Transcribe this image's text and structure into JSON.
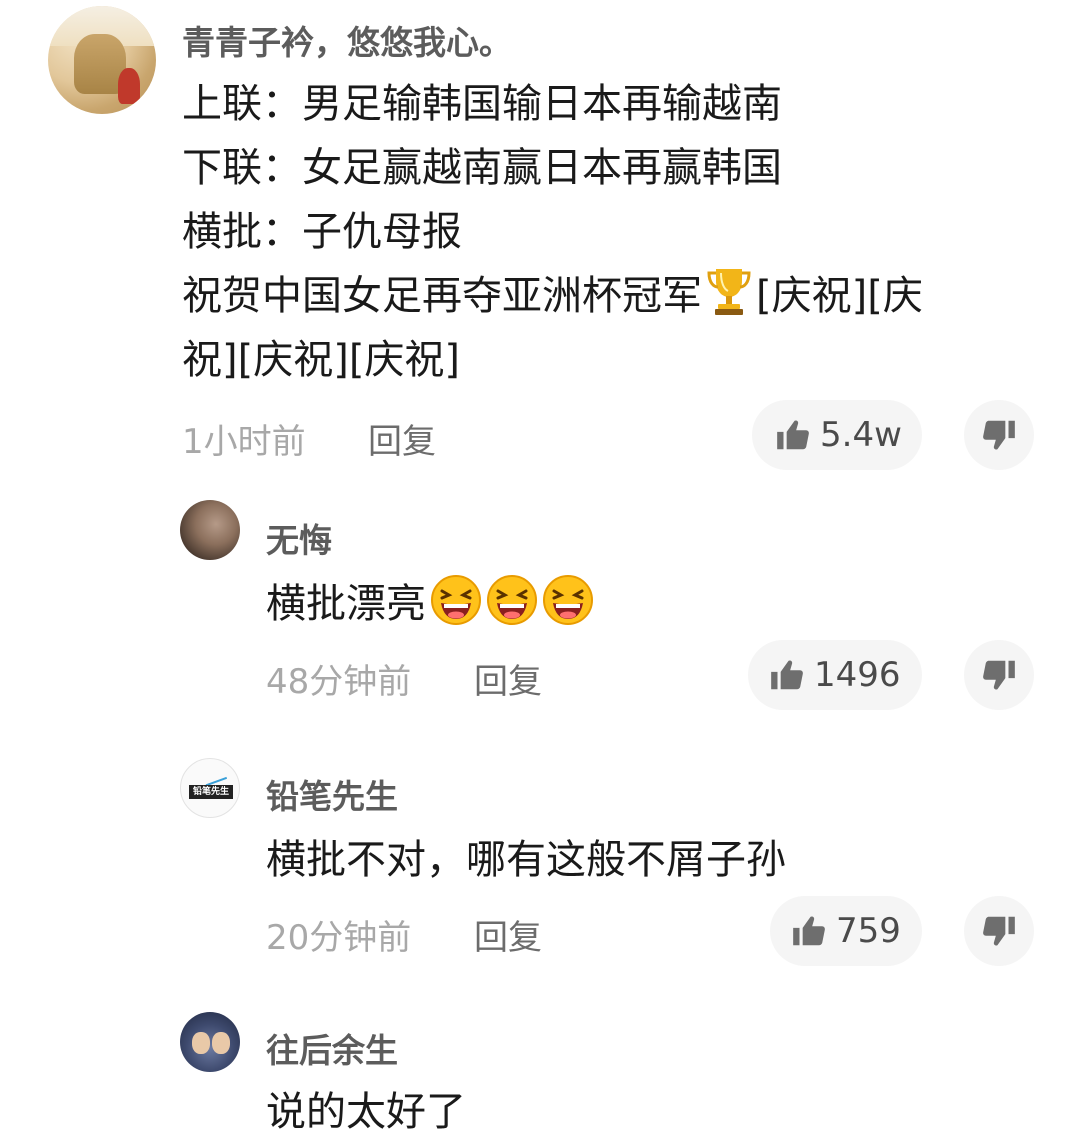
{
  "comments": {
    "main": {
      "username": "青青子衿，悠悠我心。",
      "lines": [
        "上联：男足输韩国输日本再输越南",
        "下联：女足赢越南赢日本再赢韩国",
        "横批：子仇母报",
        "祝贺中国女足再夺亚洲杯冠军",
        "祝][庆祝][庆祝]"
      ],
      "line4_suffix": "[庆祝][庆",
      "time": "1小时前",
      "reply_label": "回复",
      "likes": "5.4w"
    },
    "reply1": {
      "username": "无悔",
      "text": "横批漂亮",
      "time": "48分钟前",
      "reply_label": "回复",
      "likes": "1496"
    },
    "reply2": {
      "username": "铅笔先生",
      "avatar_text": "铅笔先生",
      "text": "横批不对，哪有这般不屑子孙",
      "time": "20分钟前",
      "reply_label": "回复",
      "likes": "759"
    },
    "reply3": {
      "username": "往后余生",
      "text": "说的太好了"
    }
  },
  "icons": {
    "like": "thumbs-up-icon",
    "dislike": "thumbs-down-icon",
    "trophy": "trophy-emoji",
    "laugh": "laughing-emoji"
  },
  "colors": {
    "username": "#5c5c5c",
    "body_text": "#1a1a1a",
    "meta_text": "#a8a8a8",
    "pill_bg": "#f5f5f5"
  }
}
